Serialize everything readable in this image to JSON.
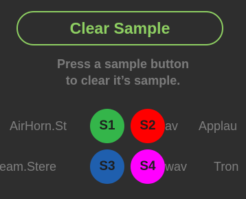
{
  "clear_button": {
    "label": "Clear Sample"
  },
  "hint": {
    "line1": "Press a sample button",
    "line2": "to clear it’s sample."
  },
  "rows": [
    {
      "left_file": "AirHorn.St",
      "mid_file": "av",
      "right_file": "Applau",
      "pads": [
        {
          "label": "S1",
          "color": "#34b54a"
        },
        {
          "label": "S2",
          "color": "#ff0000"
        }
      ]
    },
    {
      "left_file": "eam.Stere",
      "mid_file": "wav",
      "right_file": "Tron",
      "pads": [
        {
          "label": "S3",
          "color": "#1f5fae"
        },
        {
          "label": "S4",
          "color": "#ff00ff"
        }
      ]
    }
  ]
}
